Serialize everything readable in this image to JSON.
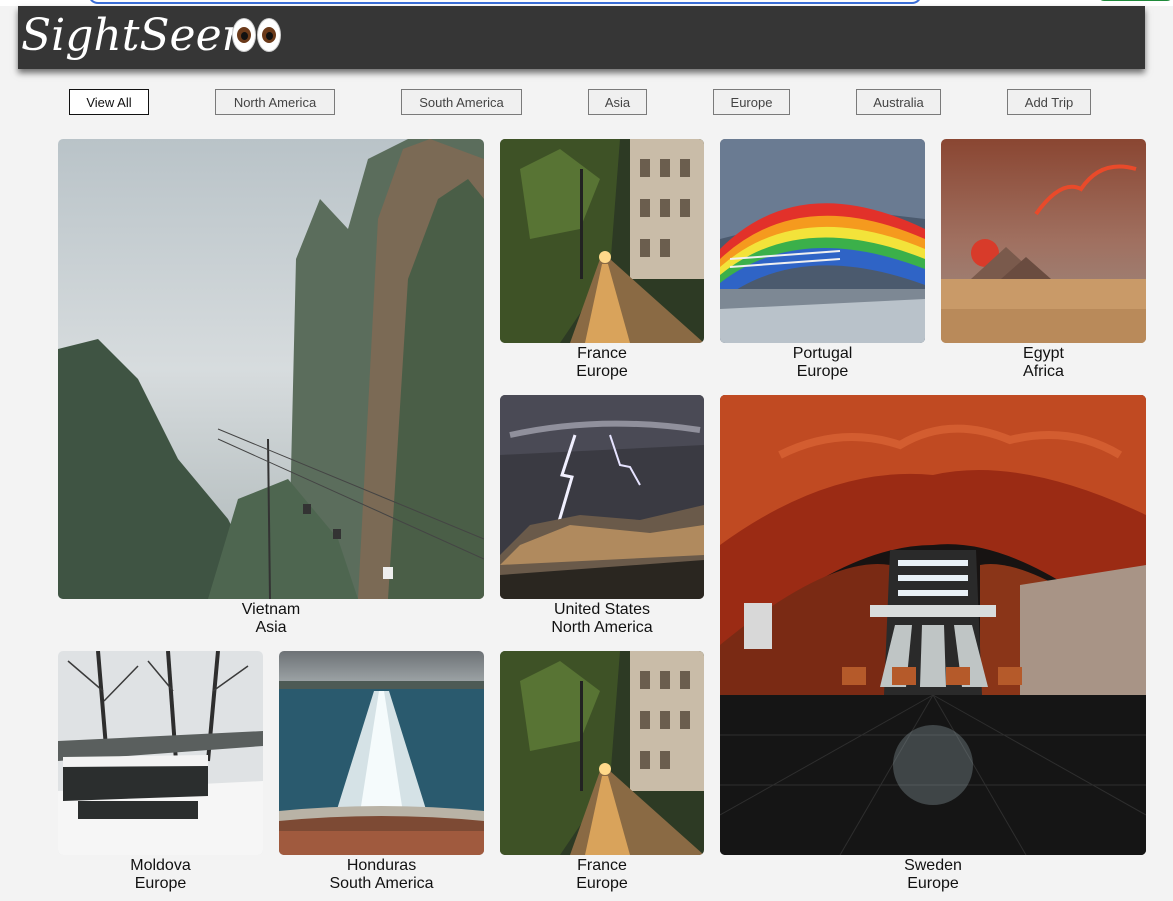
{
  "app": {
    "logo_text": "SightSeer",
    "logo_icon": "eyes-emoji"
  },
  "nav": {
    "buttons": [
      {
        "label": "View All",
        "active": true
      },
      {
        "label": "North America"
      },
      {
        "label": "South America"
      },
      {
        "label": "Asia"
      },
      {
        "label": "Europe"
      },
      {
        "label": "Australia"
      },
      {
        "label": "Add Trip"
      }
    ]
  },
  "gallery": [
    {
      "country": "Vietnam",
      "region": "Asia"
    },
    {
      "country": "France",
      "region": "Europe"
    },
    {
      "country": "Portugal",
      "region": "Europe"
    },
    {
      "country": "Egypt",
      "region": "Africa"
    },
    {
      "country": "United States",
      "region": "North America"
    },
    {
      "country": "Sweden",
      "region": "Europe"
    },
    {
      "country": "Moldova",
      "region": "Europe"
    },
    {
      "country": "Honduras",
      "region": "South America"
    },
    {
      "country": "France",
      "region": "Europe"
    }
  ]
}
